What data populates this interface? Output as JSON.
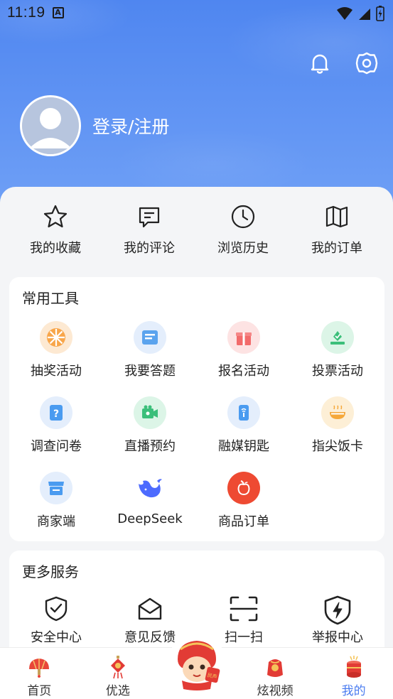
{
  "status_bar": {
    "time": "11:19",
    "notif_letter": "A"
  },
  "profile": {
    "login_label": "登录/注册"
  },
  "quick_links": [
    {
      "label": "我的收藏",
      "icon": "star-icon"
    },
    {
      "label": "我的评论",
      "icon": "comment-icon"
    },
    {
      "label": "浏览历史",
      "icon": "clock-icon"
    },
    {
      "label": "我的订单",
      "icon": "map-book-icon"
    }
  ],
  "common_tools": {
    "title": "常用工具",
    "items": [
      {
        "label": "抽奖活动",
        "icon": "lottery-wheel-icon"
      },
      {
        "label": "我要答题",
        "icon": "quiz-icon"
      },
      {
        "label": "报名活动",
        "icon": "gift-icon"
      },
      {
        "label": "投票活动",
        "icon": "vote-icon"
      },
      {
        "label": "调查问卷",
        "icon": "survey-icon"
      },
      {
        "label": "直播预约",
        "icon": "live-camera-icon"
      },
      {
        "label": "融媒钥匙",
        "icon": "media-key-icon"
      },
      {
        "label": "指尖饭卡",
        "icon": "meal-card-icon"
      },
      {
        "label": "商家端",
        "icon": "merchant-shop-icon"
      },
      {
        "label": "DeepSeek",
        "icon": "deepseek-whale-icon"
      },
      {
        "label": "商品订单",
        "icon": "goods-order-icon"
      }
    ]
  },
  "more_services": {
    "title": "更多服务",
    "items": [
      {
        "label": "安全中心",
        "icon": "shield-check-icon"
      },
      {
        "label": "意见反馈",
        "icon": "envelope-open-icon"
      },
      {
        "label": "扫一扫",
        "icon": "scan-icon"
      },
      {
        "label": "举报中心",
        "icon": "report-shield-icon"
      }
    ]
  },
  "tabbar": [
    {
      "label": "首页",
      "icon": "fan-home-icon",
      "active": false
    },
    {
      "label": "优选",
      "icon": "lantern-knot-icon",
      "active": false
    },
    {
      "label": "炫视频",
      "icon": "red-bag-icon",
      "active": false
    },
    {
      "label": "我的",
      "icon": "drum-gift-icon",
      "active": true
    }
  ],
  "mascot_text": "民声"
}
